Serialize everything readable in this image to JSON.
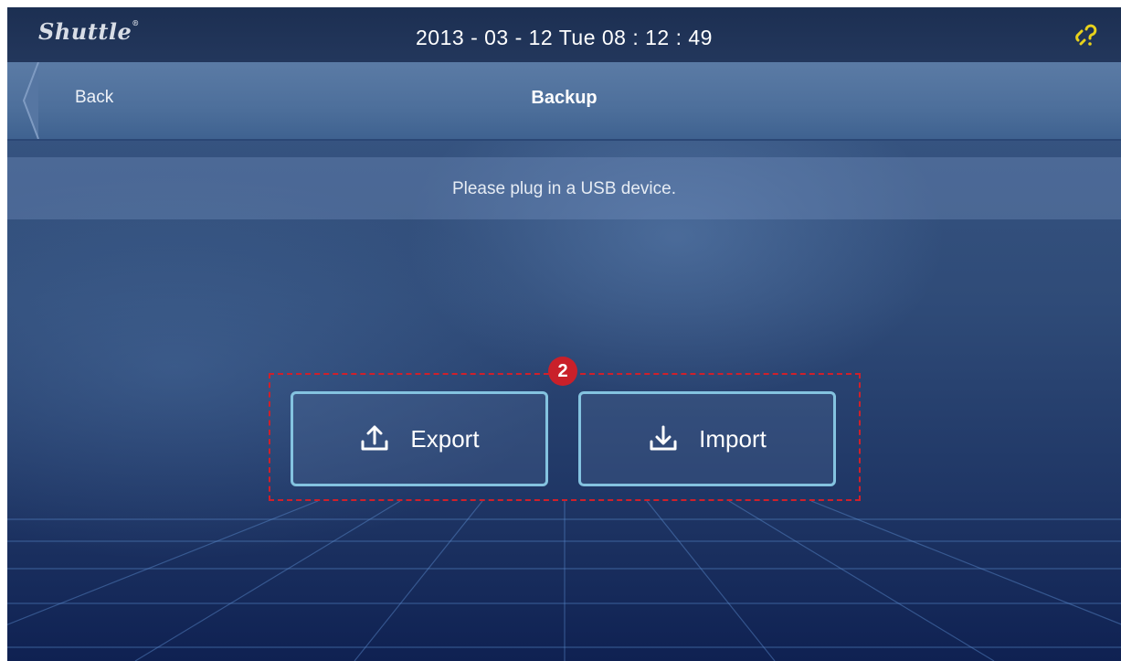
{
  "header": {
    "brand": "Shuttle",
    "brand_mark": "®",
    "datetime": "2013 - 03 - 12  Tue  08 : 12 : 49",
    "status_icon": "link-help-icon"
  },
  "nav": {
    "back_label": "Back",
    "title": "Backup"
  },
  "message": "Please plug in a USB device.",
  "callout": {
    "number": "2",
    "color": "#d0202a"
  },
  "actions": [
    {
      "label": "Export",
      "icon": "upload-icon"
    },
    {
      "label": "Import",
      "icon": "download-icon"
    }
  ],
  "colors": {
    "button_border": "#84c3e0",
    "accent_yellow": "#e8d21c"
  }
}
